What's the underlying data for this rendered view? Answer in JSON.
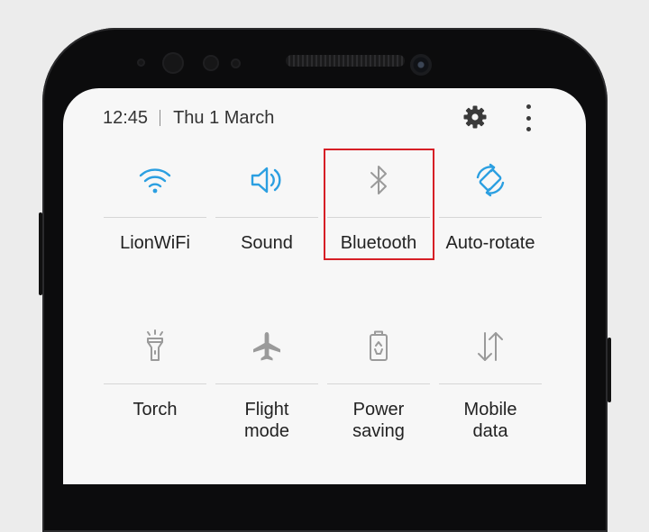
{
  "status_bar": {
    "time": "12:45",
    "date": "Thu 1 March"
  },
  "header_icons": [
    "gear-icon",
    "more-options-icon"
  ],
  "tiles": [
    {
      "label": "LionWiFi",
      "icon": "wifi-icon",
      "state": "on"
    },
    {
      "label": "Sound",
      "icon": "speaker-icon",
      "state": "on"
    },
    {
      "label": "Bluetooth",
      "icon": "bluetooth-icon",
      "state": "off",
      "highlighted": true
    },
    {
      "label": "Auto-rotate",
      "icon": "auto-rotate-icon",
      "state": "on"
    },
    {
      "label": "Torch",
      "icon": "flashlight-icon",
      "state": "off"
    },
    {
      "label": "Flight\nmode",
      "icon": "airplane-icon",
      "state": "off"
    },
    {
      "label": "Power\nsaving",
      "icon": "battery-saver-icon",
      "state": "off"
    },
    {
      "label": "Mobile\ndata",
      "icon": "mobile-data-icon",
      "state": "off"
    }
  ],
  "colors": {
    "active_icon": "#2b9fe1",
    "inactive_icon": "#9a9a9a",
    "highlight_border": "#d61f26",
    "panel_background": "#f7f7f7"
  }
}
